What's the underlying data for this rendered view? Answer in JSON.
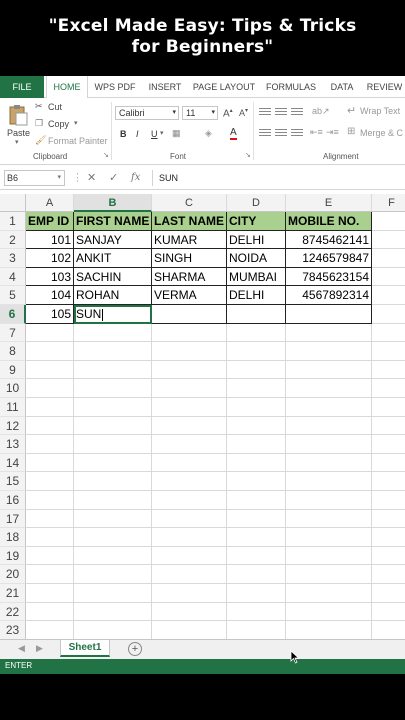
{
  "caption": {
    "line1": "\"Excel Made Easy: Tips & Tricks",
    "line2": "for Beginners\""
  },
  "ribbon": {
    "tabs": [
      "FILE",
      "HOME",
      "WPS PDF",
      "INSERT",
      "PAGE LAYOUT",
      "FORMULAS",
      "DATA",
      "REVIEW"
    ],
    "active_tab": "HOME",
    "clipboard": {
      "paste": "Paste",
      "cut": "Cut",
      "copy": "Copy",
      "format_painter": "Format Painter",
      "group_label": "Clipboard"
    },
    "font": {
      "font_name": "Calibri",
      "font_size": "11",
      "bold": "B",
      "italic": "I",
      "underline": "U",
      "group_label": "Font"
    },
    "alignment": {
      "wrap_text": "Wrap Text",
      "merge": "Merge & C",
      "group_label": "Alignment"
    }
  },
  "formula_bar": {
    "name_box": "B6",
    "fx": "fx",
    "content": "SUN"
  },
  "grid": {
    "columns": [
      "A",
      "B",
      "C",
      "D",
      "E",
      "F"
    ],
    "selected_column": "B",
    "row_numbers": [
      "1",
      "2",
      "3",
      "4",
      "5",
      "6",
      "7",
      "8",
      "9",
      "10",
      "11",
      "12",
      "13",
      "14",
      "15",
      "16",
      "17",
      "18",
      "19",
      "20",
      "21",
      "22",
      "23"
    ],
    "selected_row": "6",
    "headers": [
      "EMP ID",
      "FIRST NAME",
      "LAST NAME",
      "CITY",
      "MOBILE NO."
    ],
    "rows": [
      [
        "101",
        "SANJAY",
        "KUMAR",
        "DELHI",
        "8745462141"
      ],
      [
        "102",
        "ANKIT",
        "SINGH",
        "NOIDA",
        "1246579847"
      ],
      [
        "103",
        "SACHIN",
        "SHARMA",
        "MUMBAI",
        "7845623154"
      ],
      [
        "104",
        "ROHAN",
        "VERMA",
        "DELHI",
        "4567892314"
      ],
      [
        "105",
        "SUN",
        "",
        "",
        ""
      ]
    ],
    "header_color": "#a9d08e"
  },
  "sheets": {
    "tabs": [
      "Sheet1"
    ],
    "add_label": "+"
  },
  "status": {
    "mode": "ENTER"
  },
  "colors": {
    "excel_green": "#217346"
  }
}
